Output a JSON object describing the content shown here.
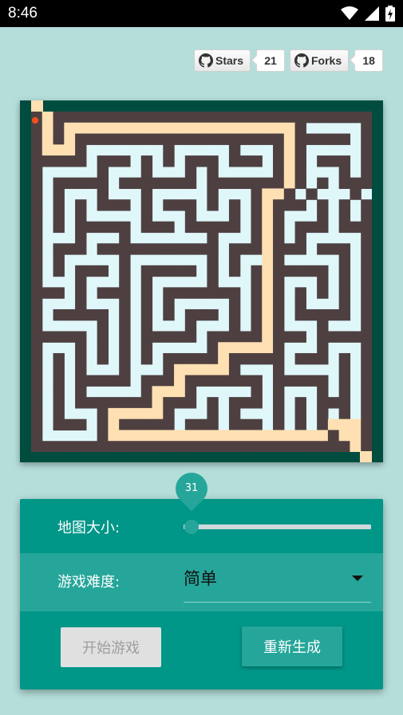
{
  "status_bar": {
    "time": "8:46"
  },
  "github": {
    "stars_label": "Stars",
    "stars_count": "21",
    "forks_label": "Forks",
    "forks_count": "18"
  },
  "maze": {
    "colors": {
      "wall": "#4e4041",
      "path": "#e0f7fa",
      "solution": "#ffe0b2",
      "border": "#004d40",
      "player": "#f4511e"
    },
    "rows": [
      "#S#############################",
      "#S#SSSSSSSSSSSSSSSSSSSSS#.....#",
      "#S#S###################S#####.#",
      "#SSS#.......#.....#...#S#.....#",
      "#####.###.#.#.###.###.#S#.###.#",
      "#.....#...#...#.#.....#S#...#.#",
      "#.#####.#######.#######S#.#.###",
      "#.#...#...#.....#...#SS#.#...#",
      "#.#.#.###.#.###.#.#.#S###.#.#.#",
      "#.#.#.....#...#...#.#S#...#.#.#",
      "#.#.#####.###.#####.#S#.###.###",
      "#...#...#.......#...#S#.#.....#",
      "#.###.###########.###S###.###.#",
      "#.#.....#.......#.#..S#.....#.#",
      "#.#.###.#.#####.#.#.#S#####.#.#",
      "#...#...#.#.....#...#S#...#.#.#",
      "###.#.###.#.#######.#S#.#.#.#.#",
      "#...#...#.#.#.....#.#S#.#...#.#",
      "#.#####.#.#.#.###.#.#S#.#####.#",
      "#.....#.#.#...#...#.#S#...#...#",
      "#####.#.#.#####.#####S###.#####",
      "#...#.#.#.#.....#SSSSS#...#...#",
      "#.#.#.#.#.#.#####S#####.###.#.#",
      "#.#.#...#...#SSSSS#...#.....#.#",
      "#.#.#####.###S#######.#####.#.#",
      "#.#.#.....#SSS#.....#.#...#.#.#",
      "#.#.#######S###.#.###.#.#.###.#",
      "#.#...#SSSSS#...#.#...#.#.#.#.#",
      "#.###.#S#####.###.###.#.#.#SSS#",
      "#.....#SSSSSSSSSSSSSSSSSSSS#SS#",
      "#############################S#"
    ]
  },
  "panel": {
    "map_size_label": "地图大小:",
    "map_size_value": "31",
    "difficulty_label": "游戏难度:",
    "difficulty_value": "简单",
    "start_button": "开始游戏",
    "regenerate_button": "重新生成"
  }
}
